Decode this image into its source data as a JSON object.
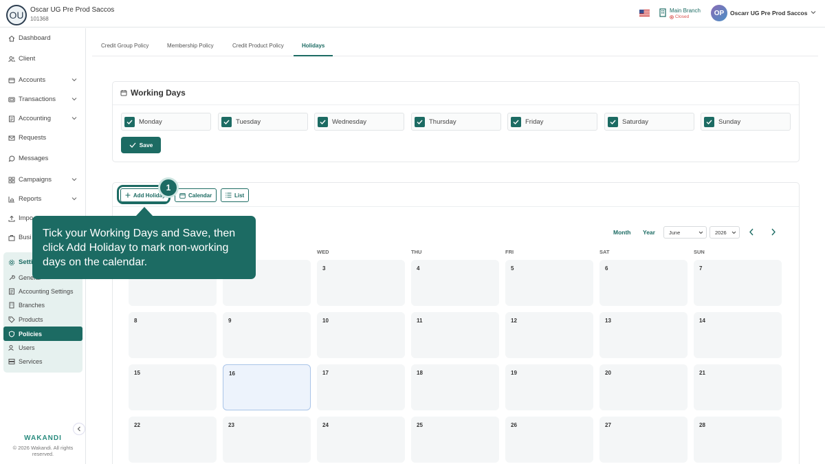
{
  "header": {
    "org_initials": "OU",
    "org_name": "Oscar UG Pre Prod Saccos",
    "org_code": "101368",
    "branch_name": "Main Branch",
    "branch_status": "Closed",
    "user_initials": "OP",
    "user_name": "Oscarr UG Pre Prod Saccos"
  },
  "sidebar": {
    "items": [
      {
        "label": "Dashboard",
        "icon": "home-icon"
      },
      {
        "label": "Client",
        "icon": "users-icon"
      },
      {
        "label": "Accounts",
        "icon": "wallet-icon"
      },
      {
        "label": "Transactions",
        "icon": "card-icon"
      },
      {
        "label": "Accounting",
        "icon": "ledger-icon"
      },
      {
        "label": "Requests",
        "icon": "mail-icon"
      },
      {
        "label": "Messages",
        "icon": "message-icon"
      },
      {
        "label": "Campaigns",
        "icon": "grid-icon"
      },
      {
        "label": "Reports",
        "icon": "chart-icon"
      },
      {
        "label": "Impo",
        "icon": "upload-icon"
      },
      {
        "label": "Busi",
        "icon": "briefcase-icon"
      },
      {
        "label": "Setti",
        "icon": "gear-icon"
      }
    ],
    "settings_sub": [
      {
        "label": "General"
      },
      {
        "label": "Accounting Settings"
      },
      {
        "label": "Branches"
      },
      {
        "label": "Products"
      },
      {
        "label": "Policies"
      },
      {
        "label": "Users"
      },
      {
        "label": "Services"
      }
    ],
    "brand": "WAKANDI",
    "copyright": "© 2026 Wakandi. All rights reserved."
  },
  "tabs": [
    "Credit Group Policy",
    "Membership Policy",
    "Credit Product Policy",
    "Holidays"
  ],
  "working_days": {
    "title": "Working Days",
    "days": [
      "Monday",
      "Tuesday",
      "Wednesday",
      "Thursday",
      "Friday",
      "Saturday",
      "Sunday"
    ],
    "save_label": "Save"
  },
  "calendar": {
    "add_holiday_label": "Add Holiday",
    "calendar_label": "Calendar",
    "list_label": "List",
    "month_label": "Month",
    "year_label": "Year",
    "month_value": "June",
    "year_value": "2026",
    "weekdays": [
      "",
      "",
      "WED",
      "THU",
      "FRI",
      "SAT",
      "SUN"
    ],
    "rows": [
      [
        "",
        "",
        "3",
        "4",
        "5",
        "6",
        "7"
      ],
      [
        "8",
        "9",
        "10",
        "11",
        "12",
        "13",
        "14"
      ],
      [
        "15",
        "16",
        "17",
        "18",
        "19",
        "20",
        "21"
      ],
      [
        "22",
        "23",
        "24",
        "25",
        "26",
        "27",
        "28"
      ]
    ],
    "today": "16"
  },
  "guide": {
    "step": "1",
    "text": "Tick your Working Days and Save, then click Add Holiday to mark non-working days on the calendar."
  },
  "colors": {
    "accent": "#1c6b63",
    "closed": "#d9534f"
  }
}
